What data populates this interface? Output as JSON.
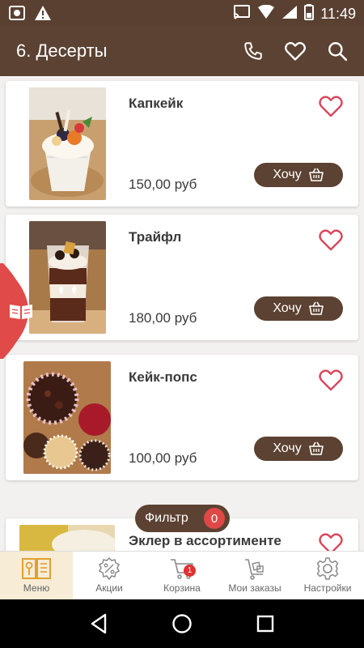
{
  "status_bar": {
    "time": "11:49"
  },
  "app_bar": {
    "title": "6. Десерты"
  },
  "products": [
    {
      "name": "Капкейк",
      "price": "150,00 руб",
      "want_label": "Хочу"
    },
    {
      "name": "Трайфл",
      "price": "180,00 руб",
      "want_label": "Хочу"
    },
    {
      "name": "Кейк-попс",
      "price": "100,00 руб",
      "want_label": "Хочу"
    },
    {
      "name": "Эклер в ассортименте"
    }
  ],
  "filter": {
    "label": "Фильтр",
    "count": "0"
  },
  "bottom_nav": {
    "items": [
      {
        "label": "Меню",
        "icon": "menu-book-icon",
        "active": true
      },
      {
        "label": "Акции",
        "icon": "percent-badge-icon"
      },
      {
        "label": "Корзина",
        "icon": "cart-icon",
        "badge": "1"
      },
      {
        "label": "Мои заказы",
        "icon": "delivery-cart-icon"
      },
      {
        "label": "Настройки",
        "icon": "gear-icon"
      }
    ]
  },
  "colors": {
    "brand_brown": "#5c4232",
    "heart_red": "#d8455a",
    "badge_red": "#e04848",
    "active_tab_bg": "#f7ecd6"
  }
}
